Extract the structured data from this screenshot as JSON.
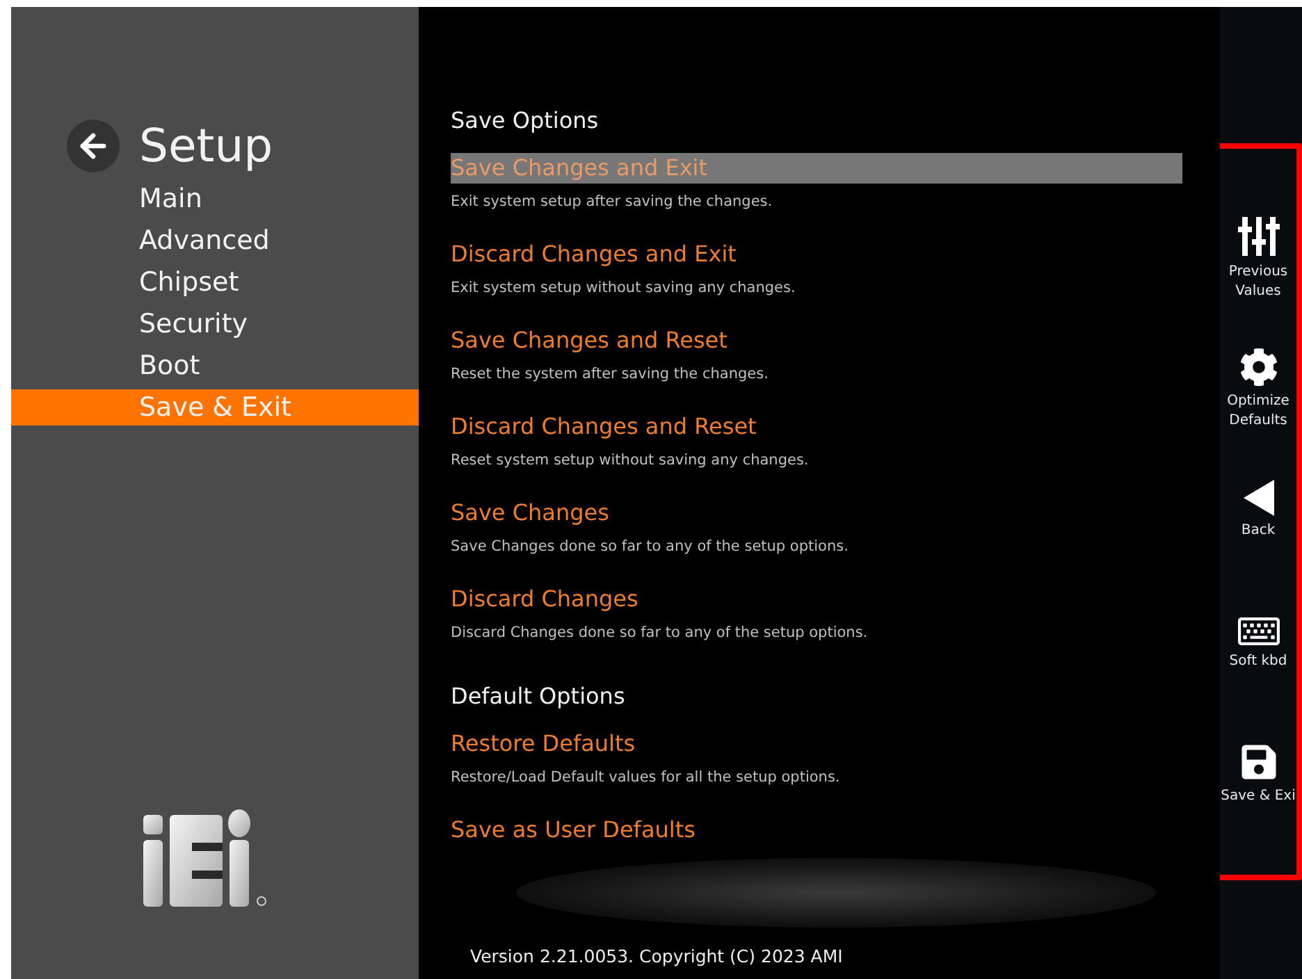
{
  "header": {
    "title": "Setup"
  },
  "menu": [
    {
      "label": "Main",
      "selected": false
    },
    {
      "label": "Advanced",
      "selected": false
    },
    {
      "label": "Chipset",
      "selected": false
    },
    {
      "label": "Security",
      "selected": false
    },
    {
      "label": "Boot",
      "selected": false
    },
    {
      "label": "Save & Exit",
      "selected": true
    }
  ],
  "options": [
    {
      "kind": "section",
      "label": "Save Options"
    },
    {
      "kind": "option",
      "label": "Save Changes and Exit",
      "description": "Exit system setup after saving the changes.",
      "selected": true
    },
    {
      "kind": "option",
      "label": "Discard Changes and Exit",
      "description": "Exit system setup without saving any changes.",
      "selected": false
    },
    {
      "kind": "option",
      "label": "Save Changes and Reset",
      "description": "Reset the system after saving the changes.",
      "selected": false
    },
    {
      "kind": "option",
      "label": "Discard Changes and Reset",
      "description": "Reset system setup without saving any changes.",
      "selected": false
    },
    {
      "kind": "option",
      "label": "Save Changes",
      "description": "Save Changes done so far to any of the setup options.",
      "selected": false
    },
    {
      "kind": "option",
      "label": "Discard Changes",
      "description": "Discard Changes done so far to any of the setup options.",
      "selected": false
    },
    {
      "kind": "section",
      "label": "Default Options"
    },
    {
      "kind": "option",
      "label": "Restore Defaults",
      "description": "Restore/Load Default values for all the setup options.",
      "selected": false
    },
    {
      "kind": "option",
      "label": "Save as User Defaults",
      "selected": false
    }
  ],
  "footer": "Version 2.21.0053. Copyright (C) 2023 AMI",
  "actions": [
    {
      "kind": "sliders",
      "label": [
        "Previous",
        "Values"
      ]
    },
    {
      "kind": "gear",
      "label": [
        "Optimize",
        "Defaults"
      ]
    },
    {
      "kind": "back",
      "label": [
        "Back"
      ]
    },
    {
      "kind": "keyboard",
      "label": [
        "Soft kbd"
      ]
    },
    {
      "kind": "floppy",
      "label": [
        "Save & Exi"
      ]
    }
  ]
}
